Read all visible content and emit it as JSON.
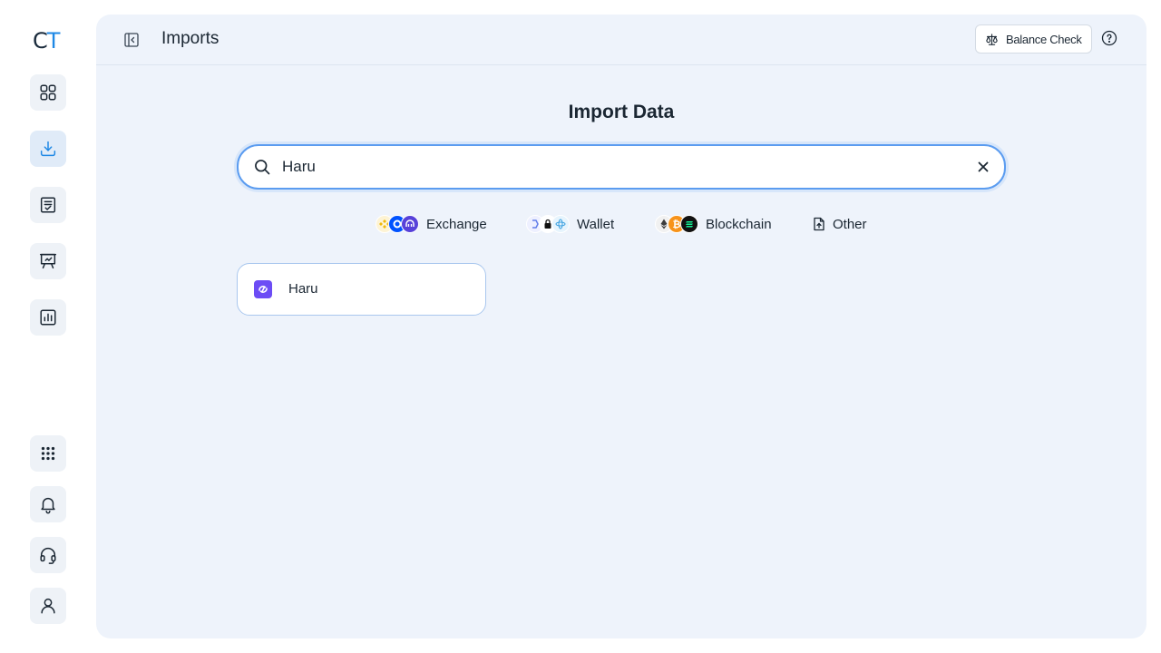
{
  "app": {
    "logo_c": "C",
    "logo_t": "T"
  },
  "sidebar": {
    "items": [
      {
        "name": "dashboard",
        "icon": "grid-icon",
        "active": false
      },
      {
        "name": "imports",
        "icon": "download-icon",
        "active": true
      },
      {
        "name": "transactions",
        "icon": "checklist-icon",
        "active": false
      },
      {
        "name": "presentation",
        "icon": "presentation-board-icon",
        "active": false
      },
      {
        "name": "reports",
        "icon": "bar-chart-icon",
        "active": false
      }
    ],
    "bottom_items": [
      {
        "name": "apps",
        "icon": "apps-grid-icon"
      },
      {
        "name": "notifications",
        "icon": "bell-icon"
      },
      {
        "name": "support",
        "icon": "headset-icon"
      },
      {
        "name": "profile",
        "icon": "user-icon"
      }
    ]
  },
  "header": {
    "title": "Imports",
    "balance_check_label": "Balance Check"
  },
  "main": {
    "heading": "Import Data",
    "search": {
      "value": "Haru",
      "placeholder": ""
    },
    "filters": [
      {
        "label": "Exchange",
        "icons": [
          "binance-icon",
          "coinbase-icon",
          "kraken-icon"
        ]
      },
      {
        "label": "Wallet",
        "icons": [
          "ethereum-wallet-icon",
          "ledger-icon",
          "electrum-icon"
        ]
      },
      {
        "label": "Blockchain",
        "icons": [
          "ethereum-icon",
          "bitcoin-icon",
          "solana-icon"
        ]
      },
      {
        "label": "Other",
        "icons": [
          "file-upload-icon"
        ]
      }
    ],
    "results": [
      {
        "name": "Haru",
        "icon": "haru-logo-icon"
      }
    ]
  },
  "colors": {
    "accent": "#1e88e5",
    "panel_bg": "#eef3fb",
    "search_border": "#5b9cf0",
    "haru_brand": "#6c4cf5"
  }
}
